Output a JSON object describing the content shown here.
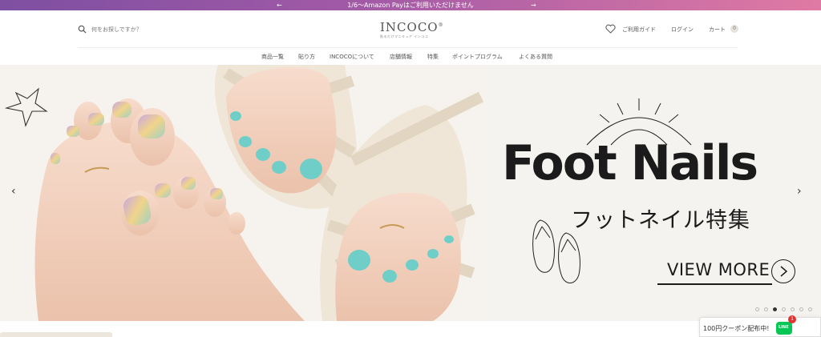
{
  "announcement": {
    "text": "1/6〜Amazon Payはご利用いただけません",
    "prev_arrow": "←",
    "next_arrow": "→"
  },
  "header": {
    "search_placeholder": "何をお探しですか？",
    "logo": "INCOCO",
    "logo_sub": "貼るだけマニキュア インココ",
    "guide": "ご利用ガイド",
    "login": "ログイン",
    "cart": "カート",
    "cart_count": "0"
  },
  "nav": {
    "items": [
      "商品一覧",
      "貼り方",
      "INCOCOについて",
      "店舗情報",
      "特集",
      "ポイントプログラム",
      "よくある質問"
    ]
  },
  "hero": {
    "headline": "Foot Nails",
    "subline": "フットネイル特集",
    "cta": "VIEW MORE",
    "prev": "‹",
    "next": "›",
    "slide_count": 7,
    "active_slide": 3
  },
  "coupon": {
    "text": "100円クーポン配布中!",
    "line_label": "LINE",
    "badge": "1"
  },
  "colors": {
    "announce_start": "#7e4fa2",
    "announce_end": "#e07aa4",
    "line_green": "#06c755",
    "text_dark": "#1b1b1b"
  }
}
